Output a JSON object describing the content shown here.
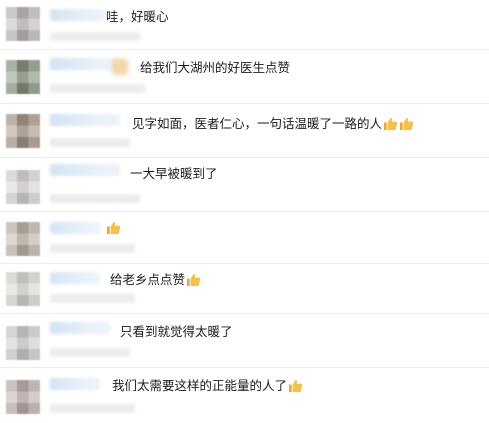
{
  "comments": [
    {
      "text": "哇，好暖心",
      "thumbs": 0
    },
    {
      "text": "给我们大湖州的好医生点赞",
      "thumbs": 0
    },
    {
      "text": "见字如面，医者仁心，一句话温暖了一路的人",
      "thumbs": 2
    },
    {
      "text": "一大早被暖到了",
      "thumbs": 0
    },
    {
      "text": "",
      "thumbs": 1
    },
    {
      "text": "给老乡点点赞",
      "thumbs": 1
    },
    {
      "text": "只看到就觉得太暖了",
      "thumbs": 0
    },
    {
      "text": "我们太需要这样的正能量的人了",
      "thumbs": 1
    }
  ],
  "icons": {
    "thumb": "thumbs-up-icon"
  },
  "colors": {
    "thumb": "#f2c14e",
    "name_blur": "#d3e4f3",
    "divider": "#ececec"
  }
}
